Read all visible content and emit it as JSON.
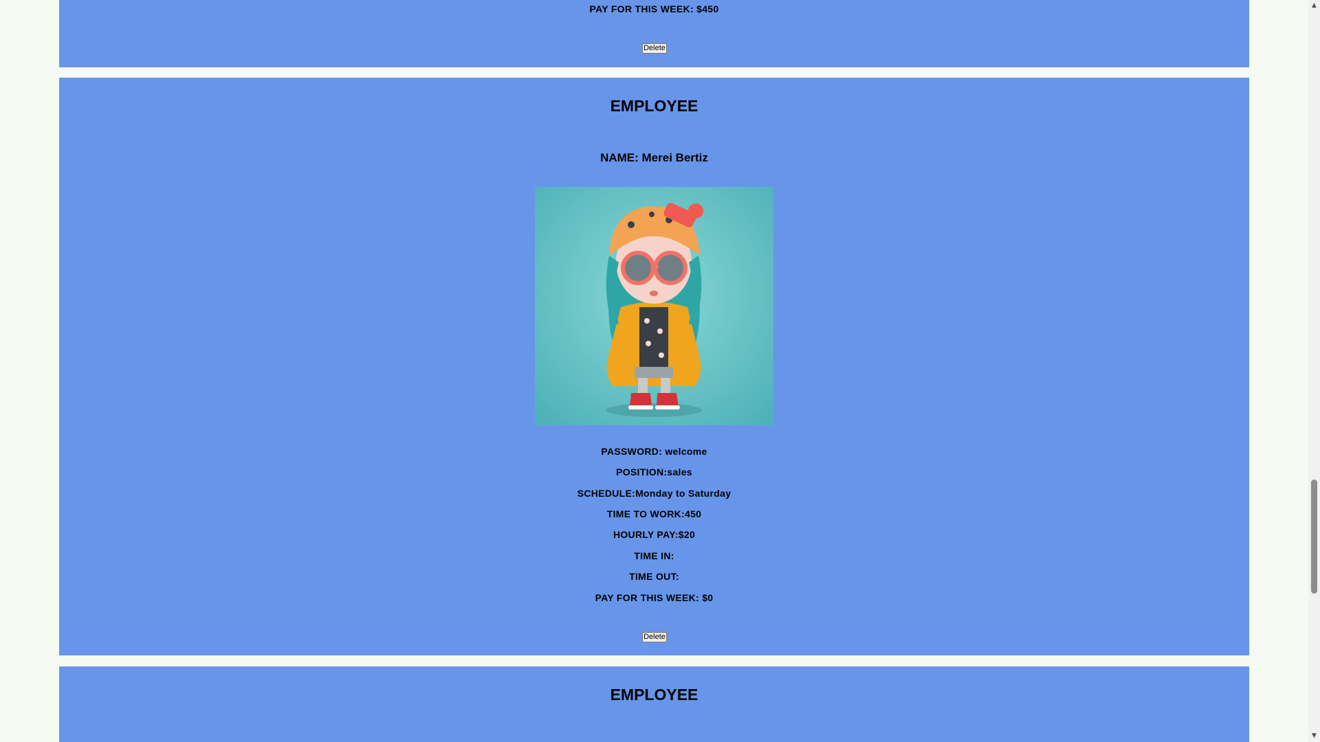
{
  "employees": [
    {
      "pay_week": "PAY FOR THIS WEEK: $450",
      "delete_label": "Delete"
    },
    {
      "title": "EMPLOYEE",
      "name": "NAME: Merei Bertiz",
      "photo_alt": "Merei Bertiz",
      "password": "PASSWORD: welcome",
      "position": "POSITION:sales",
      "schedule": "SCHEDULE:Monday to Saturday",
      "time_to_work": "TIME TO WORK:450",
      "hourly_pay": "HOURLY PAY:$20",
      "time_in": "TIME IN:",
      "time_out": "TIME OUT:",
      "pay_week": "PAY FOR THIS WEEK: $0",
      "delete_label": "Delete"
    },
    {
      "title": "EMPLOYEE"
    }
  ],
  "colors": {
    "page_background": "#f5fbf3",
    "card_background": "#6795ea"
  },
  "icons": {
    "scroll_up": "scroll-up-arrow-icon",
    "scroll_down": "scroll-down-arrow-icon"
  }
}
